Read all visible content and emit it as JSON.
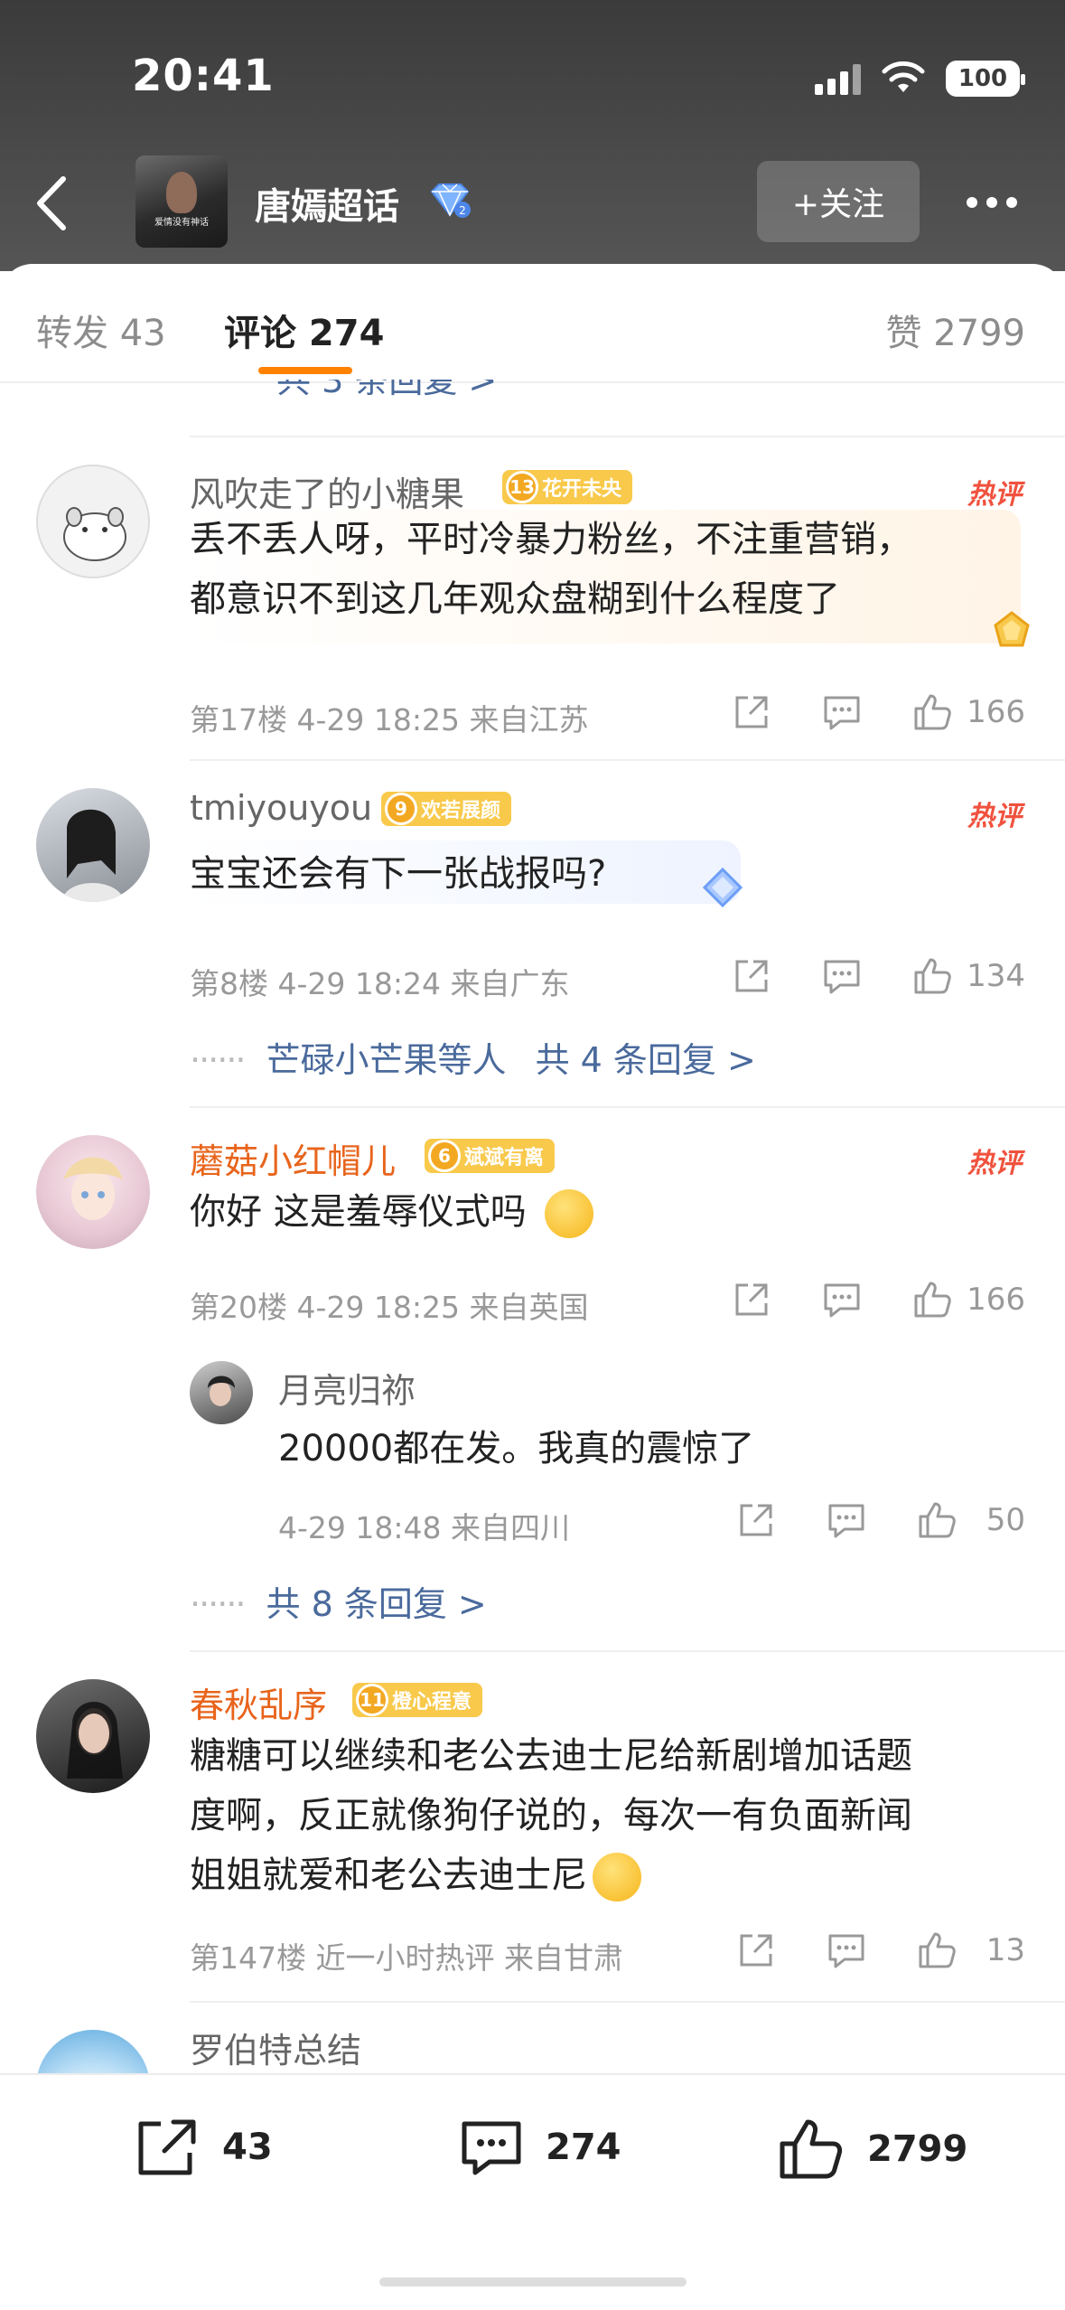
{
  "status_bar": {
    "time": "20:41",
    "battery": "100"
  },
  "topic": {
    "title": "唐嫣超话",
    "follow_label": "+关注",
    "cover_text": "爱情没有神话"
  },
  "tabs": {
    "repost": "转发 43",
    "comments": "评论 274",
    "likes": "赞 2799"
  },
  "cut_reply": "共 3 条回复 >",
  "comments": [
    {
      "username": "风吹走了的小糖果",
      "level": "13",
      "badge": "花开未央",
      "hot_label": "热评",
      "text_lines": [
        "丢不丢人呀，平时冷暴力粉丝，不注重营销，",
        "都意识不到这几年观众盘糊到什么程度了"
      ],
      "meta": "第17楼  4-29 18:25  来自江苏",
      "likes": "166"
    },
    {
      "username": "tmiyouyou",
      "level": "9",
      "badge": "欢若展颜",
      "hot_label": "热评",
      "text_lines": [
        "宝宝还会有下一张战报吗?"
      ],
      "meta": "第8楼  4-29 18:24  来自广东",
      "likes": "134",
      "replies_link": {
        "names": "芒碌小芒果等人",
        "total": "共 4 条回复 >"
      }
    },
    {
      "username": "蘑菇小红帽儿",
      "level": "6",
      "badge": "斌斌有离",
      "hot_label": "热评",
      "text_lines": [
        "你好 这是羞辱仪式吗"
      ],
      "meta": "第20楼  4-29 18:25  来自英国",
      "likes": "166",
      "sub_reply": {
        "username": "月亮归祢",
        "text": "20000都在发。我真的震惊了",
        "meta": "4-29 18:48  来自四川",
        "likes": "50"
      },
      "replies_link": {
        "total": "共 8 条回复 >"
      }
    },
    {
      "username": "春秋乱序",
      "level": "11",
      "badge": "橙心程意",
      "text_lines": [
        "糖糖可以继续和老公去迪士尼给新剧增加话题",
        "度啊，反正就像狗仔说的，每次一有负面新闻",
        "姐姐就爱和老公去迪士尼"
      ],
      "meta": "第147楼  近一小时热评  来自甘肃",
      "likes": "13"
    },
    {
      "username": "罗伯特总结"
    }
  ],
  "bottom_bar": {
    "repost_count": "43",
    "comment_count": "274",
    "like_count": "2799"
  },
  "colors": {
    "accent": "#ff8200",
    "link": "#4a6a9c",
    "hot": "#f0523e",
    "badge": "#f8c94b"
  }
}
